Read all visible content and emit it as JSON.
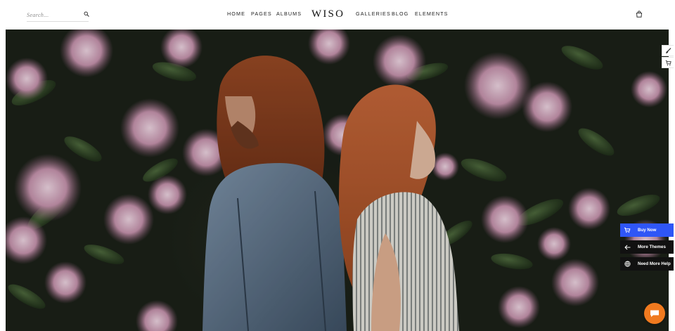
{
  "header": {
    "search_placeholder": "Search...",
    "logo": "WISO",
    "nav_left": [
      "HOME",
      "PAGES",
      "ALBUMS"
    ],
    "nav_right": [
      "GALLERIES",
      "BLOG",
      "ELEMENTS"
    ]
  },
  "promo": {
    "buy_now": "Buy Now",
    "more_themes": "More Themes",
    "need_help": "Need More Help"
  },
  "colors": {
    "accent_blue": "#2f56f6",
    "chat_orange": "#f07a1f",
    "dark_button": "#111111"
  },
  "icons": [
    "search-icon",
    "shopping-bag-icon",
    "paintbrush-icon",
    "cart-icon",
    "arrow-left-icon",
    "globe-icon",
    "chat-icon"
  ]
}
